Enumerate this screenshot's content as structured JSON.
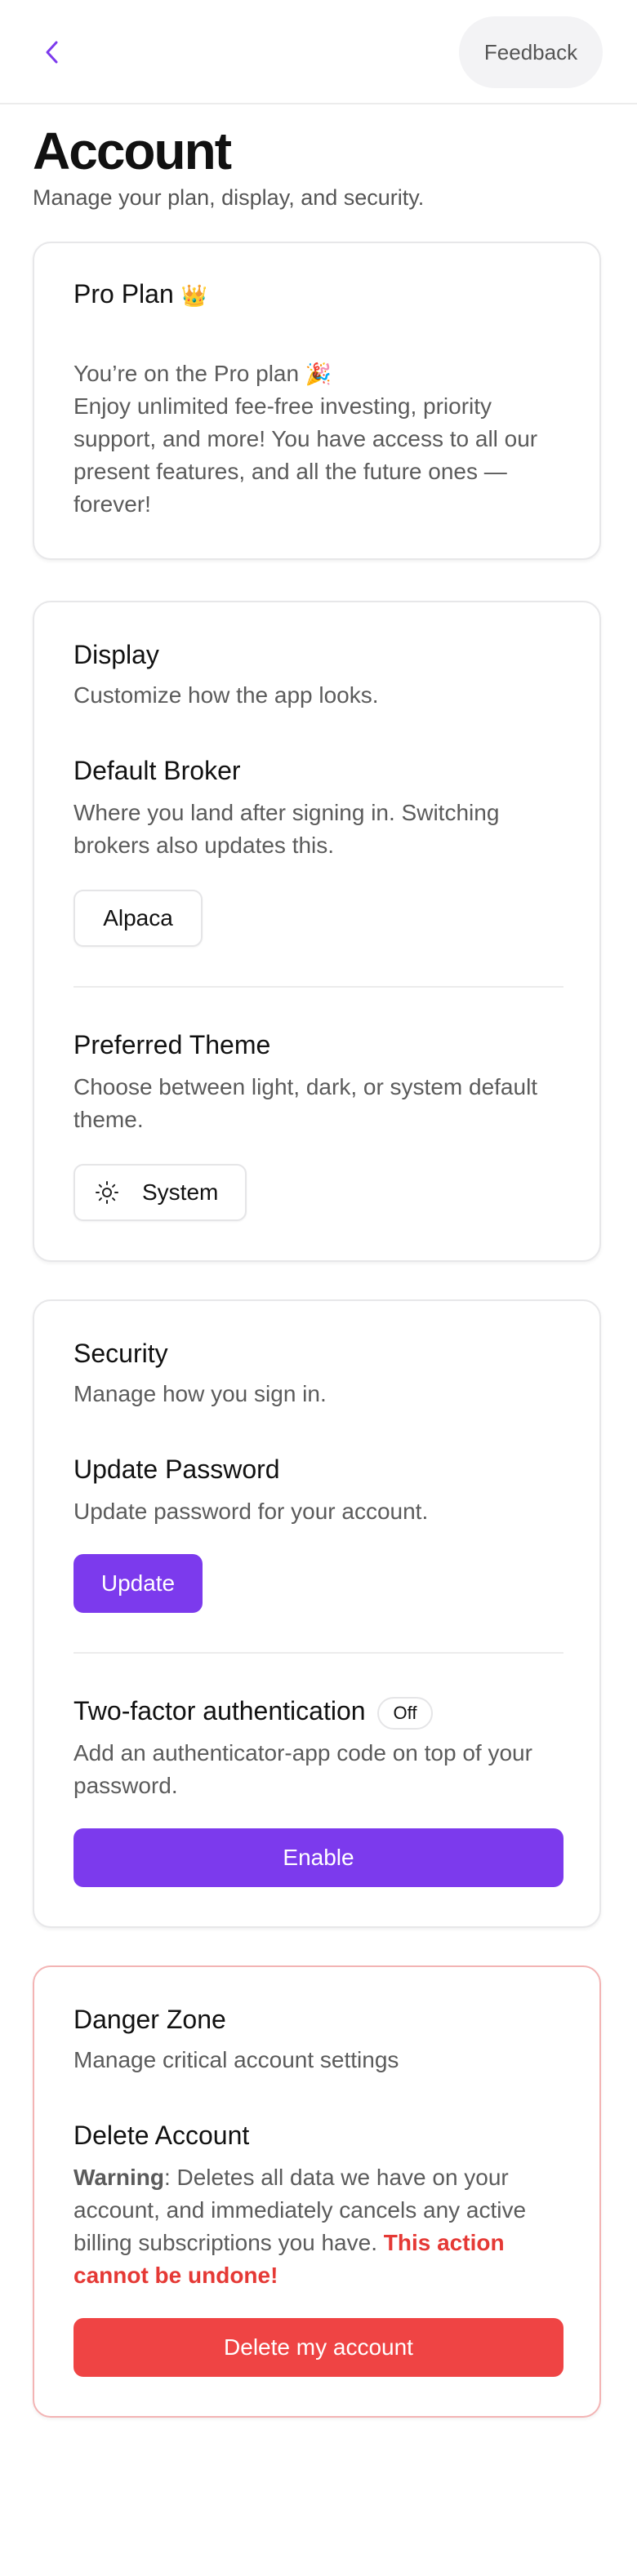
{
  "header": {
    "feedback_label": "Feedback"
  },
  "page": {
    "title": "Account",
    "subtitle": "Manage your plan, display, and security."
  },
  "plan": {
    "title": "Pro Plan",
    "title_emoji": "👑",
    "status_line": "You’re on the Pro plan",
    "status_emoji": "🎉",
    "description": "Enjoy unlimited fee-free investing, priority support, and more! You have access to all our present features, and all the future ones — forever!"
  },
  "display": {
    "title": "Display",
    "subtitle": "Customize how the app looks.",
    "broker": {
      "title": "Default Broker",
      "description": "Where you land after signing in. Switching brokers also updates this.",
      "value": "Alpaca"
    },
    "theme": {
      "title": "Preferred Theme",
      "description": "Choose between light, dark, or system default theme.",
      "value": "System",
      "icon": "sun-icon"
    }
  },
  "security": {
    "title": "Security",
    "subtitle": "Manage how you sign in.",
    "password": {
      "title": "Update Password",
      "description": "Update password for your account.",
      "button_label": "Update"
    },
    "two_factor": {
      "title": "Two-factor authentication",
      "status": "Off",
      "description": "Add an authenticator-app code on top of your password.",
      "button_label": "Enable"
    }
  },
  "danger": {
    "title": "Danger Zone",
    "subtitle": "Manage critical account settings",
    "delete": {
      "title": "Delete Account",
      "warning_label": "Warning",
      "warning_text": ": Deletes all data we have on your account, and immediately cancels any active billing subscriptions you have. ",
      "warning_emphasis": "This action cannot be undone!",
      "button_label": "Delete my account"
    }
  },
  "colors": {
    "accent": "#7c3aed",
    "danger": "#ef4444",
    "danger_border": "#f3b4b4"
  }
}
